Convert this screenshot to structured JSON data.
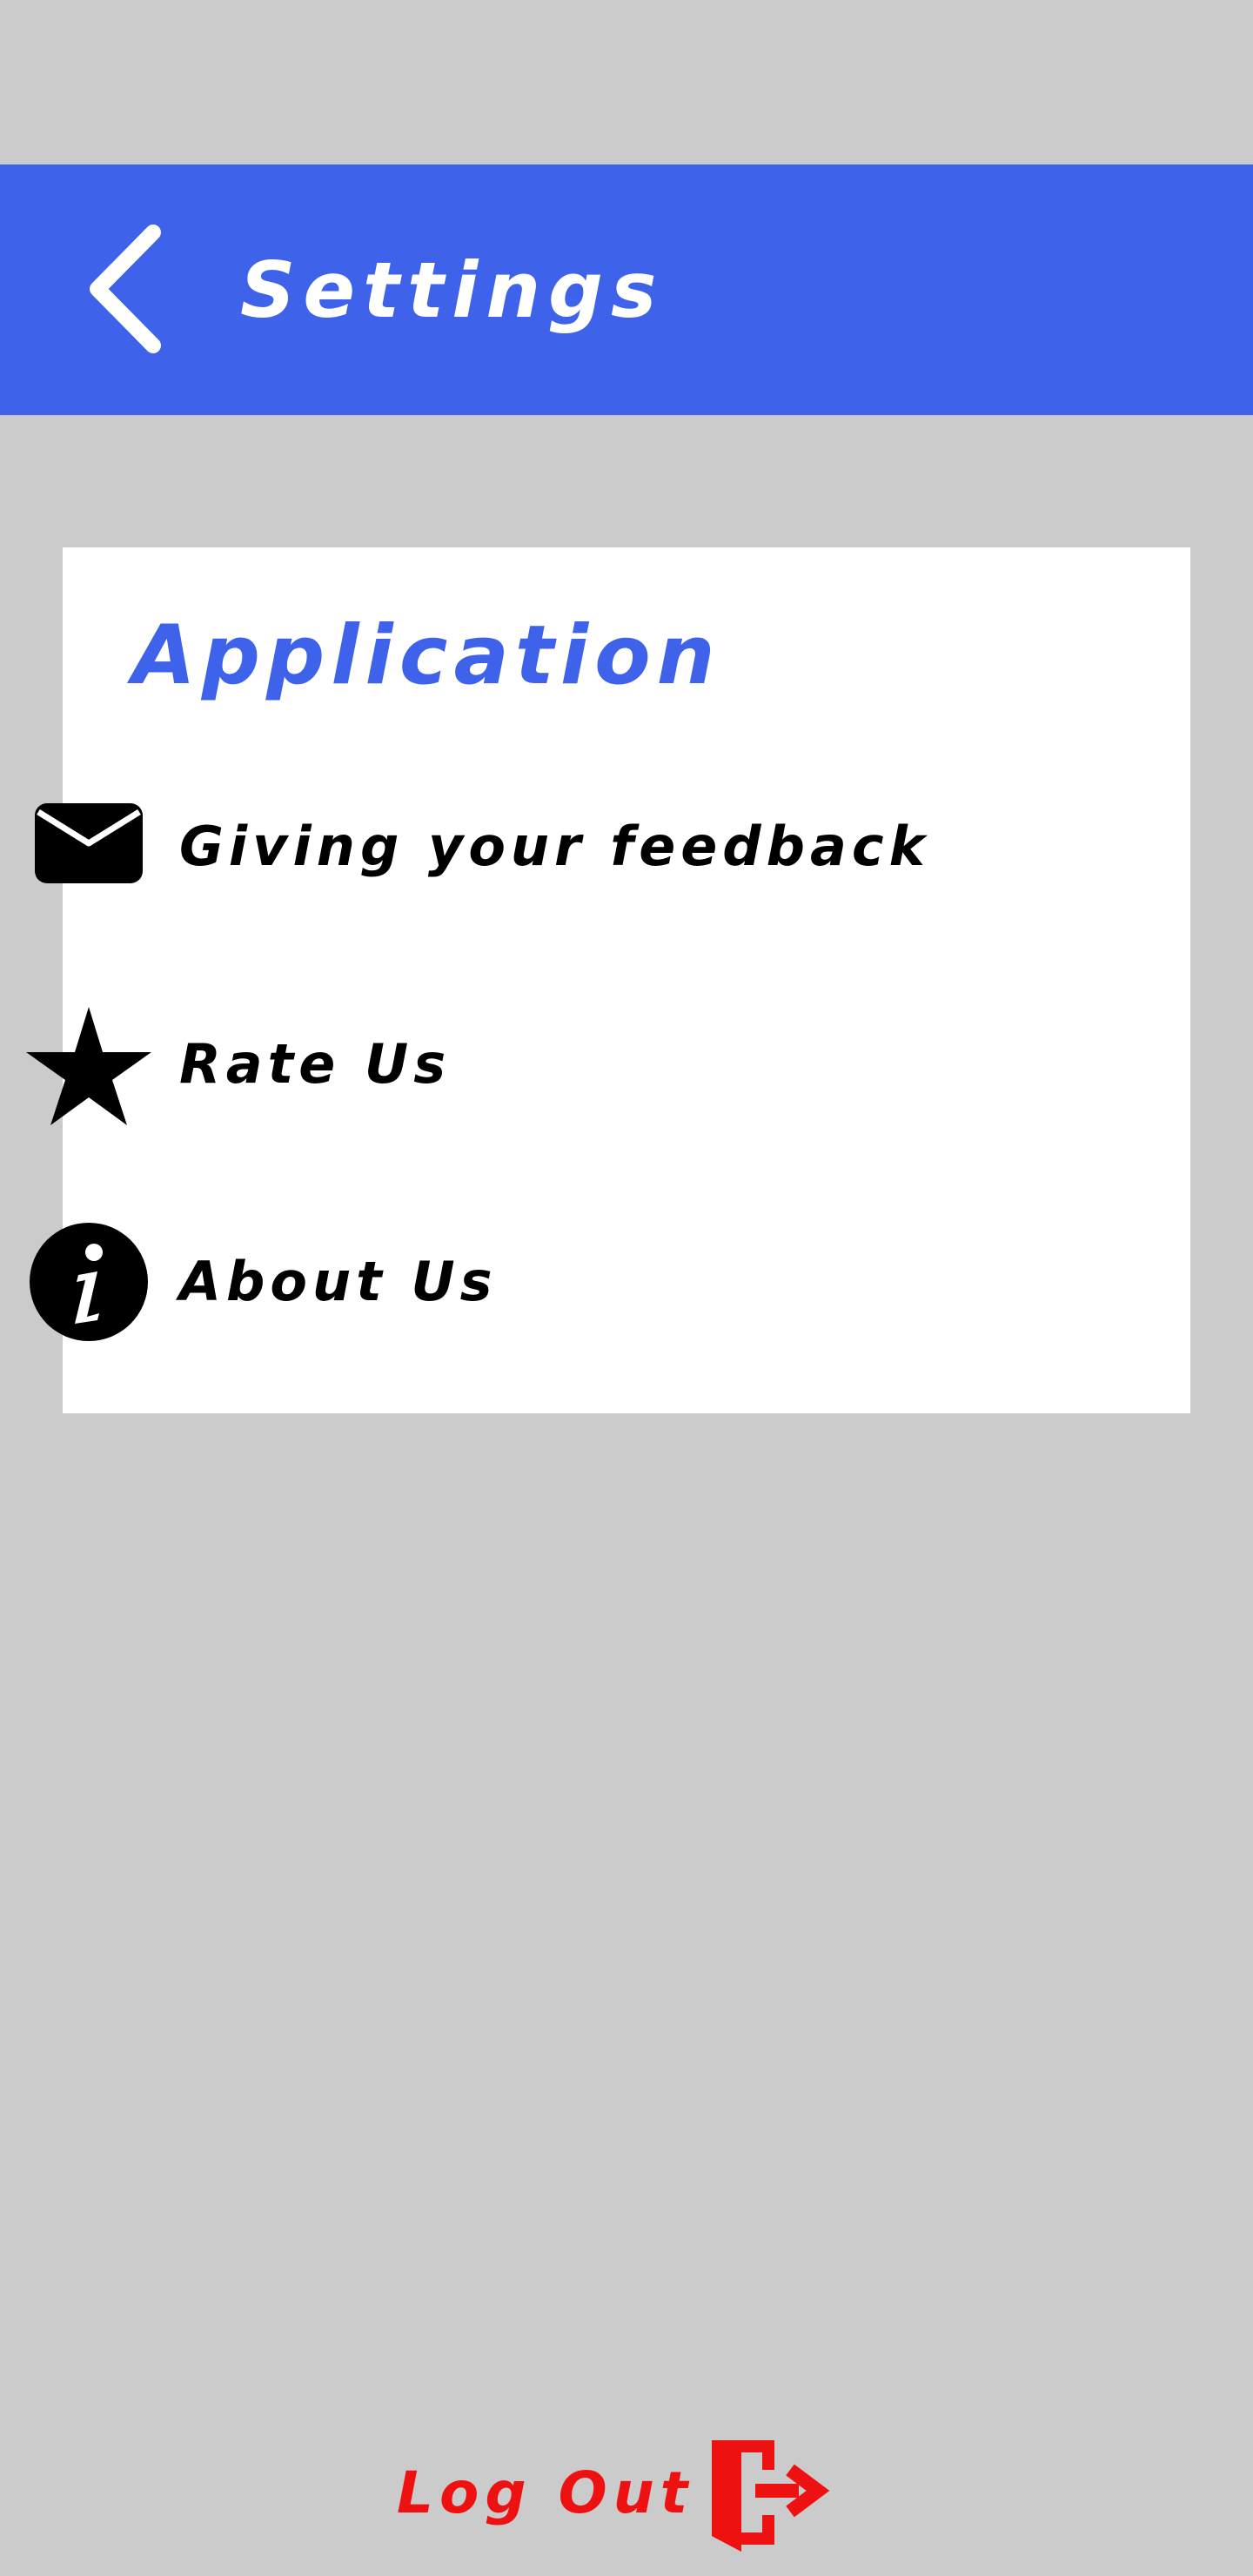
{
  "colors": {
    "background": "#cbcbcb",
    "accent": "#3e62e9",
    "card": "#ffffff",
    "text": "#000000",
    "danger": "#ee1111"
  },
  "header": {
    "back_icon": "chevron-left-icon",
    "title": "Settings"
  },
  "section": {
    "title": "Application",
    "items": [
      {
        "icon": "mail-icon",
        "label": "Giving your feedback"
      },
      {
        "icon": "star-icon",
        "label": "Rate Us"
      },
      {
        "icon": "info-icon",
        "label": "About Us"
      }
    ]
  },
  "logout": {
    "label": "Log Out",
    "icon": "logout-door-icon"
  }
}
